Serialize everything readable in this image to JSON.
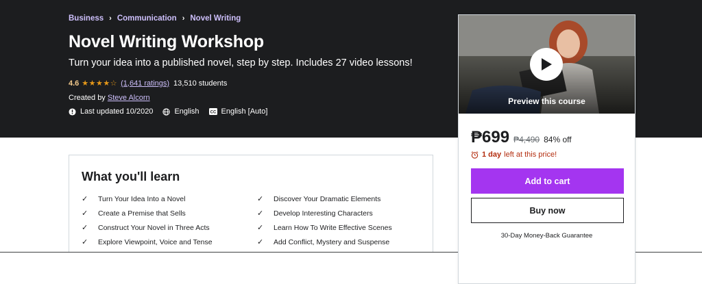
{
  "breadcrumb": [
    "Business",
    "Communication",
    "Novel Writing"
  ],
  "course": {
    "title": "Novel Writing Workshop",
    "subtitle": "Turn your idea into a published novel, step by step. Includes 27 video lessons!",
    "rating": "4.6",
    "stars": "★★★★☆",
    "ratings_count": "(1,641 ratings)",
    "students": "13,510 students",
    "created_by_label": "Created by",
    "author": "Steve Alcorn",
    "last_updated": "Last updated 10/2020",
    "language": "English",
    "captions": "English [Auto]"
  },
  "sidebar": {
    "preview_label": "Preview this course",
    "price": "₱699",
    "original_price": "₱4,490",
    "discount": "84% off",
    "urgency_bold": "1 day",
    "urgency_text": "left at this price!",
    "add_to_cart": "Add to cart",
    "buy_now": "Buy now",
    "guarantee": "30-Day Money-Back Guarantee"
  },
  "learn": {
    "title": "What you'll learn",
    "items": [
      "Turn Your Idea Into a Novel",
      "Discover Your Dramatic Elements",
      "Create a Premise that Sells",
      "Develop Interesting Characters",
      "Construct Your Novel in Three Acts",
      "Learn How To Write Effective Scenes",
      "Explore Viewpoint, Voice and Tense",
      "Add Conflict, Mystery and Suspense"
    ]
  },
  "colors": {
    "hero_bg": "#1c1d1f",
    "accent_purple": "#a435f0",
    "link_lavender": "#cec0fc",
    "star_orange": "#e59819",
    "urgency_red": "#b32d0f"
  },
  "icons": {
    "alert": "alert-icon",
    "globe": "globe-icon",
    "captions": "closed-captions-icon",
    "play": "play-icon",
    "alarm": "alarm-clock-icon",
    "check": "checkmark-icon"
  }
}
